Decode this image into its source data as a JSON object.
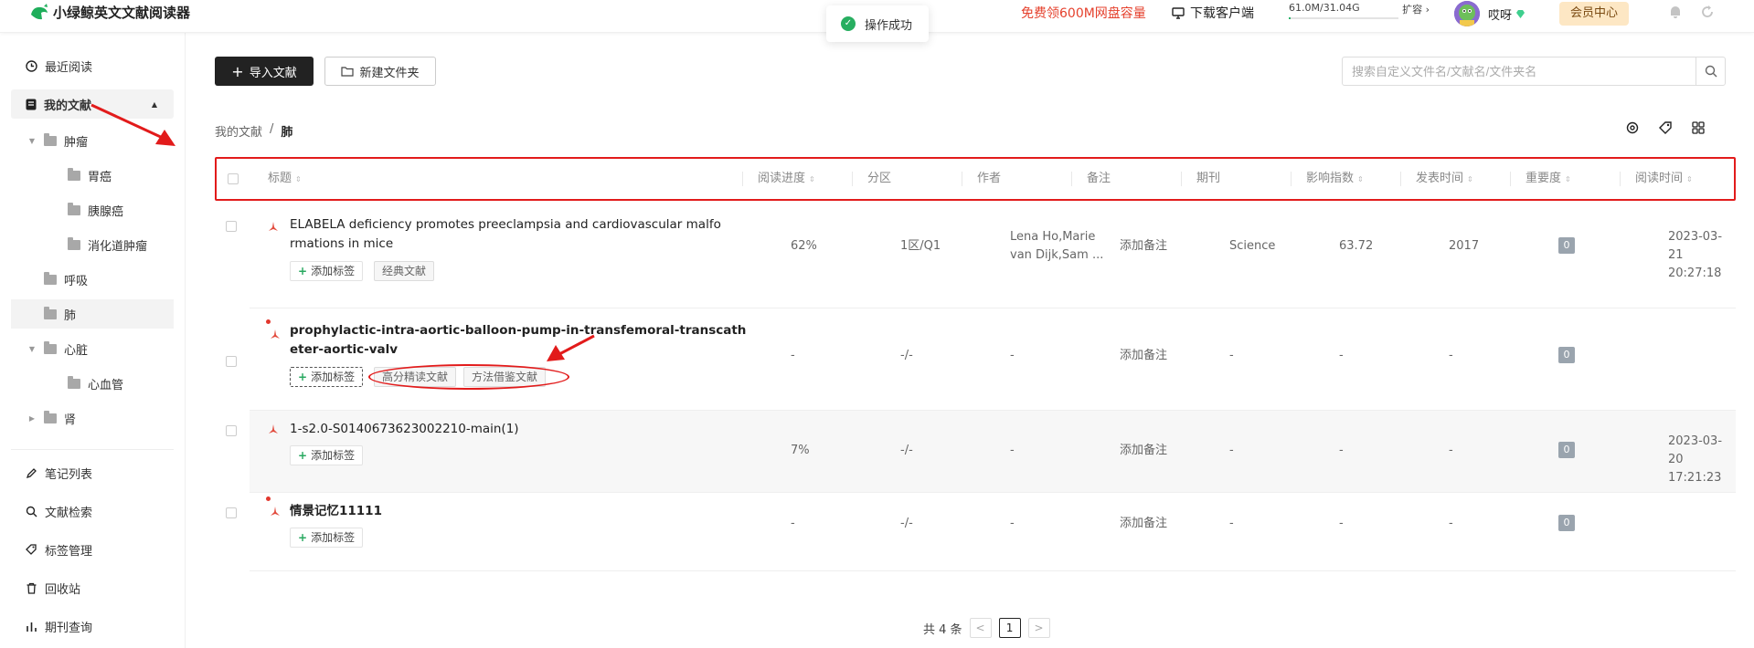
{
  "app": {
    "title": "小绿鲸英文文献阅读器"
  },
  "toast": {
    "text": "操作成功"
  },
  "header": {
    "promo": "免费领600M网盘容量",
    "download": "下载客户端",
    "storage": "61.0M/31.04G",
    "storage_used_fraction": 0.02,
    "expand": "扩容",
    "username": "哎呀",
    "vip": "会员中心"
  },
  "sidebar": {
    "recent": "最近阅读",
    "my_docs": "我的文献",
    "tree": [
      "肿瘤",
      "胃癌",
      "胰腺癌",
      "消化道肿瘤",
      "呼吸",
      "肺",
      "心脏",
      "心血管",
      "肾"
    ],
    "notes": "笔记列表",
    "search": "文献检索",
    "tags": "标签管理",
    "trash": "回收站",
    "journal": "期刊查询"
  },
  "toolbar": {
    "import": "导入文献",
    "new_folder": "新建文件夹",
    "search_placeholder": "搜索自定义文件名/文献名/文件夹名"
  },
  "breadcrumb": {
    "root": "我的文献",
    "sep": "/",
    "current": "肺"
  },
  "table": {
    "headers": [
      "标题",
      "阅读进度",
      "分区",
      "作者",
      "备注",
      "期刊",
      "影响指数",
      "发表时间",
      "重要度",
      "阅读时间"
    ],
    "rows": [
      {
        "title1": "ELABELA deficiency promotes preeclampsia and cardiovascular malfo",
        "title2": "rmations in mice",
        "add_tag": "添加标签",
        "tags": [
          "经典文献"
        ],
        "progress": "62%",
        "zone": "1区/Q1",
        "author1": "Lena Ho,Marie",
        "author2": "van Dijk,Sam ...",
        "note": "添加备注",
        "journal": "Science",
        "impact": "63.72",
        "year": "2017",
        "importance": "0",
        "read_date": "2023-03-21",
        "read_time": "20:27:18"
      },
      {
        "title1": "prophylactic-intra-aortic-balloon-pump-in-transfemoral-transcath",
        "title2": "eter-aortic-valv",
        "add_tag": "添加标签",
        "tags": [
          "高分精读文献",
          "方法借鉴文献"
        ],
        "progress": "-",
        "zone": "-/-",
        "author1": "-",
        "note": "添加备注",
        "journal": "-",
        "impact": "-",
        "year": "-",
        "importance": "0"
      },
      {
        "title1": "1-s2.0-S0140673623002210-main(1)",
        "add_tag": "添加标签",
        "progress": "7%",
        "zone": "-/-",
        "author1": "-",
        "note": "添加备注",
        "journal": "-",
        "impact": "-",
        "year": "-",
        "importance": "0",
        "read_date": "2023-03-20",
        "read_time": "17:21:23"
      },
      {
        "title1": "情景记忆11111",
        "add_tag": "添加标签",
        "progress": "-",
        "zone": "-/-",
        "author1": "-",
        "note": "添加备注",
        "journal": "-",
        "impact": "-",
        "year": "-",
        "importance": "0"
      }
    ]
  },
  "pager": {
    "total": "共 4 条",
    "prev": "<",
    "page": "1",
    "next": ">"
  },
  "colors": {
    "accent": "#222222",
    "annotation": "#e21b1b",
    "brand_green": "#27a85f",
    "promo": "#e5412d"
  }
}
